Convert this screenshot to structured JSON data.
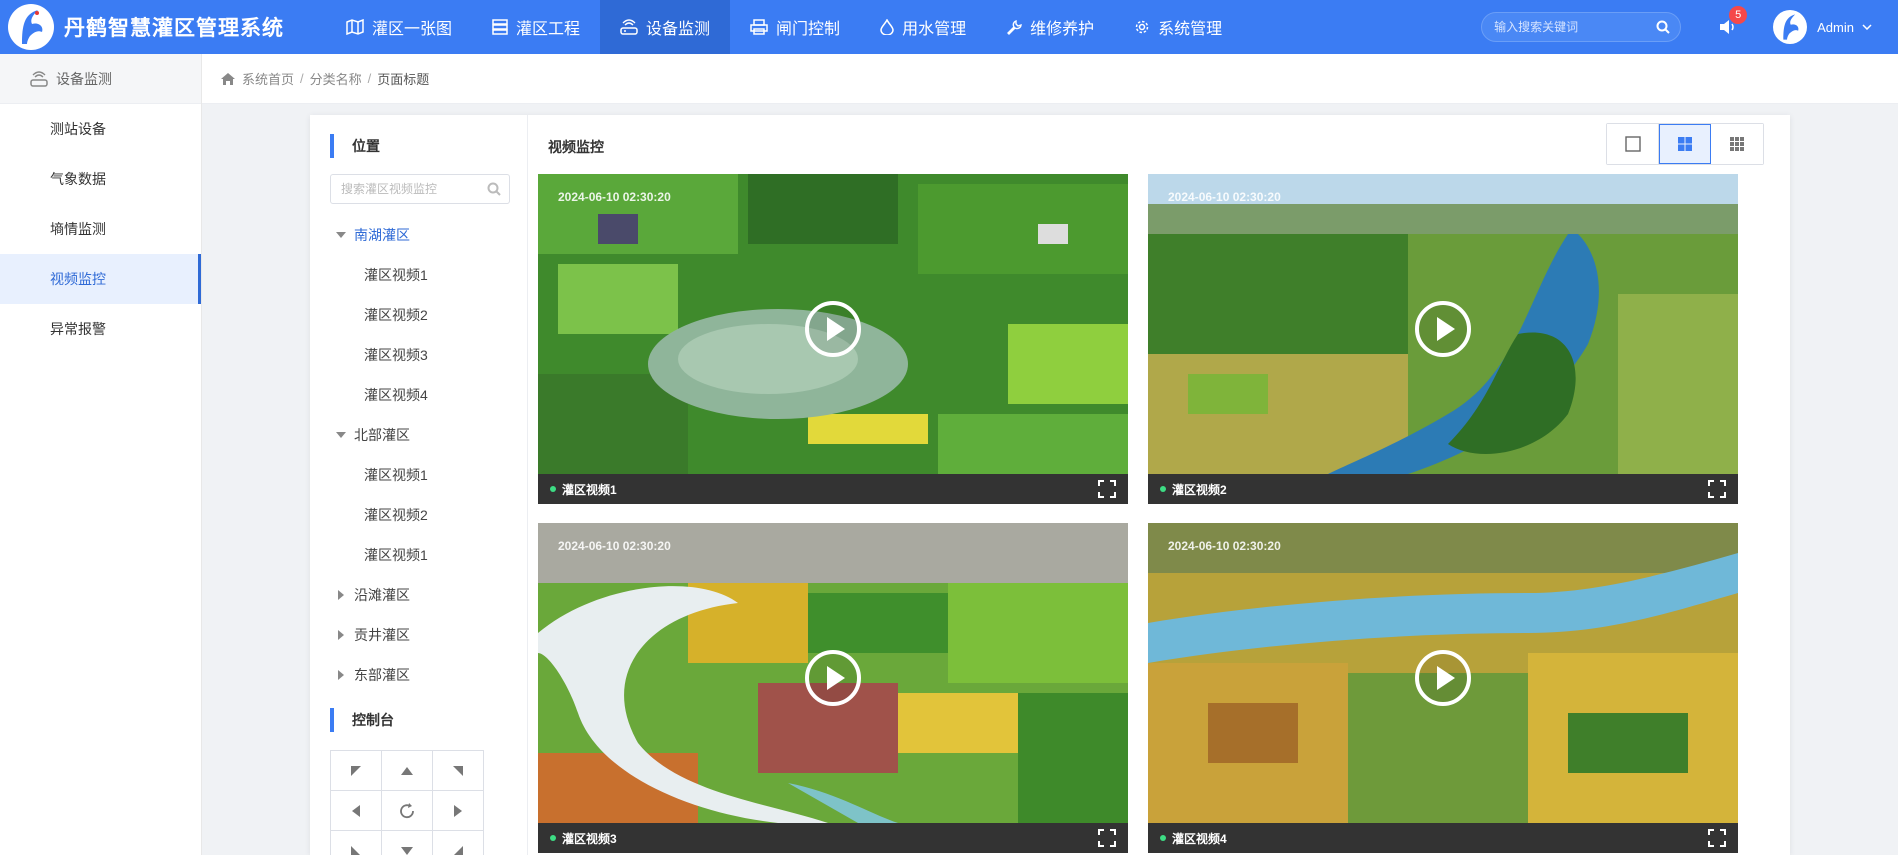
{
  "app": {
    "title": "丹鹤智慧灌区管理系统"
  },
  "nav": [
    {
      "label": "灌区一张图",
      "icon": "map-icon",
      "active": false
    },
    {
      "label": "灌区工程",
      "icon": "server-icon",
      "active": false
    },
    {
      "label": "设备监测",
      "icon": "router-icon",
      "active": true
    },
    {
      "label": "闸门控制",
      "icon": "printer-icon",
      "active": false
    },
    {
      "label": "用水管理",
      "icon": "water-drop-icon",
      "active": false
    },
    {
      "label": "维修养护",
      "icon": "wrench-icon",
      "active": false
    },
    {
      "label": "系统管理",
      "icon": "gear-icon",
      "active": false
    }
  ],
  "top_search": {
    "placeholder": "输入搜索关键词"
  },
  "notifications": {
    "count": "5"
  },
  "user": {
    "name": "Admin"
  },
  "sidebar": {
    "header": "设备监测",
    "items": [
      {
        "label": "测站设备",
        "active": false
      },
      {
        "label": "气象数据",
        "active": false
      },
      {
        "label": "墒情监测",
        "active": false
      },
      {
        "label": "视频监控",
        "active": true
      },
      {
        "label": "异常报警",
        "active": false
      }
    ]
  },
  "breadcrumb": {
    "home": "系统首页",
    "category": "分类名称",
    "current": "页面标题"
  },
  "tree": {
    "title": "位置",
    "search_placeholder": "搜索灌区视频监控",
    "groups": [
      {
        "label": "南湖灌区",
        "expanded": true,
        "children": [
          "灌区视频1",
          "灌区视频2",
          "灌区视频3",
          "灌区视频4"
        ]
      },
      {
        "label": "北部灌区",
        "expanded": true,
        "children": [
          "灌区视频1",
          "灌区视频2",
          "灌区视频1"
        ]
      },
      {
        "label": "沿滩灌区",
        "expanded": false,
        "children": []
      },
      {
        "label": "贡井灌区",
        "expanded": false,
        "children": []
      },
      {
        "label": "东部灌区",
        "expanded": false,
        "children": []
      }
    ]
  },
  "console": {
    "title": "控制台",
    "buttons": [
      "up-left-arrow-icon",
      "up-arrow-icon",
      "up-right-arrow-icon",
      "left-arrow-icon",
      "refresh-icon",
      "right-arrow-icon",
      "down-left-arrow-icon",
      "down-arrow-icon",
      "down-right-arrow-icon"
    ]
  },
  "video_panel": {
    "title": "视频监控",
    "layout_options": [
      "single-view-icon",
      "four-grid-icon",
      "nine-grid-icon"
    ],
    "active_layout": "four-grid-icon",
    "videos": [
      {
        "name": "灌区视频1",
        "timestamp": "2024-06-10 02:30:20"
      },
      {
        "name": "灌区视频2",
        "timestamp": "2024-06-10 02:30:20"
      },
      {
        "name": "灌区视频3",
        "timestamp": "2024-06-10 02:30:20"
      },
      {
        "name": "灌区视频4",
        "timestamp": "2024-06-10 02:30:20"
      }
    ]
  },
  "colors": {
    "primary": "#3b7cf3",
    "nav_active": "#2f6ad6",
    "badge": "#f5484a",
    "online_dot": "#3ddc84",
    "video_bar": "#333333"
  }
}
